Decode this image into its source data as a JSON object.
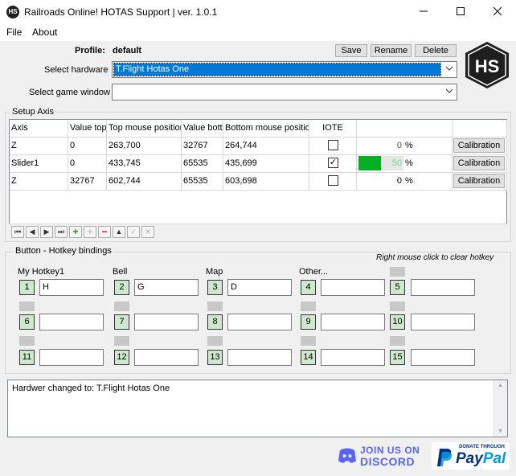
{
  "window": {
    "title": "Railroads Online! HOTAS Support | ver. 1.0.1",
    "icon_text": "HS",
    "minimize_icon": "minimize-icon",
    "maximize_icon": "maximize-icon",
    "close_icon": "close-icon"
  },
  "menu": {
    "file": "File",
    "about": "About"
  },
  "profile": {
    "label": "Profile:",
    "value": "default",
    "save": "Save",
    "rename": "Rename",
    "delete": "Delete"
  },
  "hardware": {
    "label": "Select hardware",
    "selected": "T.Flight Hotas One"
  },
  "game_window": {
    "label": "Select game window",
    "selected": ""
  },
  "logo_text": "HS",
  "setup_axis": {
    "title": "Setup Axis",
    "columns": [
      "Axis",
      "Value top",
      "Top  mouse position",
      "Value bottom",
      "Bottom mouse position",
      "IOTE",
      "",
      ""
    ],
    "rows": [
      {
        "axis": "Z",
        "value_top": "0",
        "top_pos": "263,700",
        "value_bottom": "32767",
        "bottom_pos": "264,744",
        "iote": false,
        "percent": 0,
        "percent_text": "0",
        "unit": "%",
        "calibration": "Calibration"
      },
      {
        "axis": "Slider1",
        "value_top": "0",
        "top_pos": "433,745",
        "value_bottom": "65535",
        "bottom_pos": "435,699",
        "iote": true,
        "percent": 50,
        "percent_text": "50",
        "unit": "%",
        "calibration": "Calibration"
      },
      {
        "axis": "Z",
        "value_top": "32767",
        "top_pos": "602,744",
        "value_bottom": "65535",
        "bottom_pos": "603,698",
        "iote": false,
        "percent": 0,
        "percent_text": "0",
        "unit": "%",
        "calibration": "Calibration"
      }
    ],
    "progress_color": "#06b025"
  },
  "navigator": {
    "first": "⏮",
    "prior": "◀",
    "next": "▶",
    "last": "⏭",
    "insert": "+",
    "delete": "−",
    "edit": "▲",
    "post": "✓",
    "cancel": "✕",
    "refresh": "+"
  },
  "hotkeys": {
    "title": "Button - Hotkey bindings",
    "hint": "Right mouse click to clear hotkey",
    "items": [
      {
        "num": "1",
        "label": "My Hotkey1",
        "value": "H"
      },
      {
        "num": "2",
        "label": "Bell",
        "value": "G"
      },
      {
        "num": "3",
        "label": "Map",
        "value": "D"
      },
      {
        "num": "4",
        "label": "Other...",
        "value": ""
      },
      {
        "num": "5",
        "label": "",
        "value": ""
      },
      {
        "num": "6",
        "label": "",
        "value": ""
      },
      {
        "num": "7",
        "label": "",
        "value": ""
      },
      {
        "num": "8",
        "label": "",
        "value": ""
      },
      {
        "num": "9",
        "label": "",
        "value": ""
      },
      {
        "num": "10",
        "label": "",
        "value": ""
      },
      {
        "num": "11",
        "label": "",
        "value": ""
      },
      {
        "num": "12",
        "label": "",
        "value": ""
      },
      {
        "num": "13",
        "label": "",
        "value": ""
      },
      {
        "num": "14",
        "label": "",
        "value": ""
      },
      {
        "num": "15",
        "label": "",
        "value": ""
      }
    ]
  },
  "log": {
    "text": "Hardwer changed to: T.Flight Hotas One"
  },
  "footer": {
    "discord_line1": "JOIN US ON",
    "discord_line2": "DISCORD",
    "paypal_small": "DONATE THROUGH",
    "paypal_pay": "Pay",
    "paypal_pal": "Pal",
    "discord_color": "#5865f2",
    "paypal_dark": "#003087",
    "paypal_light": "#009cde"
  }
}
